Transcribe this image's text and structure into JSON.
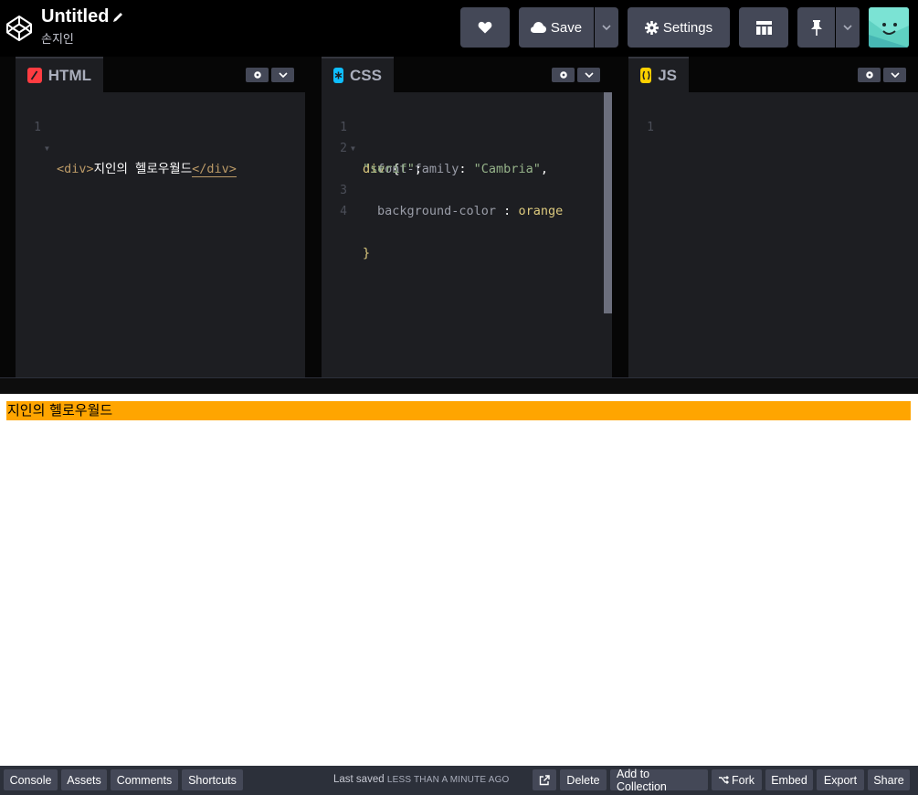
{
  "header": {
    "title": "Untitled",
    "owner": "손지인",
    "save_label": "Save",
    "settings_label": "Settings"
  },
  "panes": {
    "html": {
      "label": "HTML",
      "lines": [
        {
          "n": "1",
          "open": "<div>",
          "text": "지인의 헬로우월드",
          "close": "</div>"
        }
      ]
    },
    "css": {
      "label": "CSS",
      "line1": {
        "n": "1",
        "sel": "div",
        "brace": " {"
      },
      "line2": {
        "n": "2",
        "prop": "font-family",
        "colon": ": ",
        "str": "\"Cambria\"",
        "comma": ","
      },
      "line2b": {
        "str": "\"serif\"",
        "semi": ";"
      },
      "line3": {
        "n": "3",
        "prop": "background-color",
        "colon": " : ",
        "val": "orange"
      },
      "line4": {
        "n": "4",
        "brace": "}"
      }
    },
    "js": {
      "label": "JS",
      "line1": {
        "n": "1"
      }
    }
  },
  "preview": {
    "div_text": "지인의 헬로우월드",
    "div_color": "#FFA500"
  },
  "footer": {
    "console": "Console",
    "assets": "Assets",
    "comments": "Comments",
    "shortcuts": "Shortcuts",
    "saved_prefix": "Last saved",
    "saved_ago": "LESS THAN A MINUTE AGO",
    "delete": "Delete",
    "add_to_collection": "Add to Collection",
    "fork": "Fork",
    "embed": "Embed",
    "export": "Export",
    "share": "Share"
  },
  "colors": {
    "html_icon": "#FF3C41",
    "css_icon": "#0EBEFF",
    "js_icon": "#FCD000",
    "button_bg": "#444857"
  }
}
